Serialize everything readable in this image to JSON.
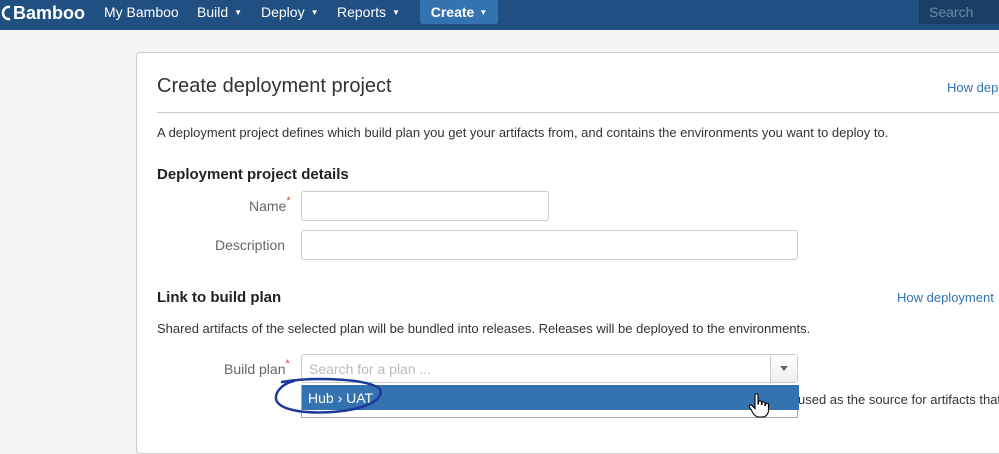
{
  "header": {
    "brand": "Bamboo",
    "nav": [
      {
        "label": "My Bamboo",
        "caret": ""
      },
      {
        "label": "Build",
        "caret": "▼"
      },
      {
        "label": "Deploy",
        "caret": "▼"
      },
      {
        "label": "Reports",
        "caret": "▼"
      }
    ],
    "create_label": "Create",
    "create_caret": "▼",
    "search_placeholder": "Search",
    "bg_color": "#205081",
    "create_color": "#3572b0"
  },
  "page": {
    "title": "Create deployment project",
    "help_link_top": "How dep",
    "intro": "A deployment project defines which build plan you get your artifacts from, and contains the environments you want to deploy to."
  },
  "details": {
    "heading": "Deployment project details",
    "name_label": "Name",
    "required_mark": "*",
    "description_label": "Description",
    "name_value": "",
    "description_value": ""
  },
  "link": {
    "heading": "Link to build plan",
    "help_link": "How deployment",
    "description": "Shared artifacts of the selected plan will be bundled into releases. Releases will be deployed to the environments.",
    "build_plan_label": "Build plan",
    "required_mark": "*",
    "search_placeholder": "Search for a plan ...",
    "options": [
      "Hub › UAT"
    ],
    "trailing_text": "used as the source for artifacts that w"
  },
  "colors": {
    "accent": "#3572b0",
    "required": "#d04437",
    "annotation": "#1b3a9c"
  }
}
